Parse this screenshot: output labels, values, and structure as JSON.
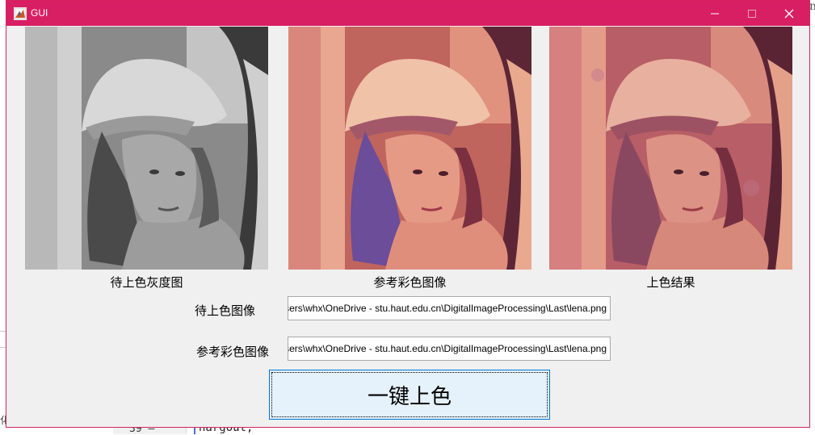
{
  "window": {
    "title": "GUI",
    "accent": "#d81f63"
  },
  "panels": [
    {
      "caption": "待上色灰度图",
      "image": "lena-grayscale"
    },
    {
      "caption": "参考彩色图像",
      "image": "lena-color-reference"
    },
    {
      "caption": "上色结果",
      "image": "lena-colorized-result"
    }
  ],
  "form": {
    "target_label": "待上色图像",
    "target_path": "C:\\Users\\whx\\OneDrive - stu.haut.edu.cn\\DigitalImageProcessing\\Last\\lena.png",
    "reference_label": "参考彩色图像",
    "reference_path": "C:\\Users\\whx\\OneDrive - stu.haut.edu.cn\\DigitalImageProcessing\\Last\\lena.png",
    "button_label": "一键上色"
  },
  "background": {
    "right_char": "n",
    "left_char": "化",
    "line_number": "39 –",
    "code_text": "nargout;"
  }
}
